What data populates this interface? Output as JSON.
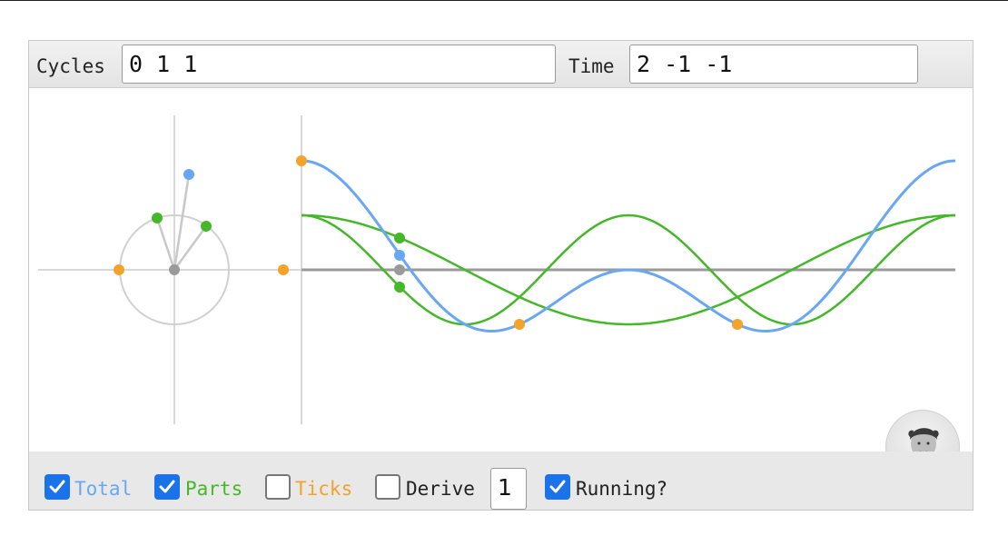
{
  "header": {
    "cycles_label": "Cycles",
    "cycles_value": "0 1 1",
    "time_label": "Time",
    "time_value": "2 -1 -1"
  },
  "footer": {
    "total_label": "Total",
    "total_checked": true,
    "parts_label": "Parts",
    "parts_checked": true,
    "ticks_label": "Ticks",
    "ticks_checked": false,
    "derive_label": "Derive",
    "derive_checked": false,
    "derive_value": "1",
    "running_label": "Running?",
    "running_checked": true
  },
  "colors": {
    "total": "#6aa7f3",
    "parts": "#44b828",
    "ticks": "#f3a22a",
    "axis": "#9a9a9a",
    "circle": "#d0d0d0",
    "checkbox": "#1a73e8"
  },
  "avatar": {
    "icon": "fourier-portrait-icon"
  }
}
